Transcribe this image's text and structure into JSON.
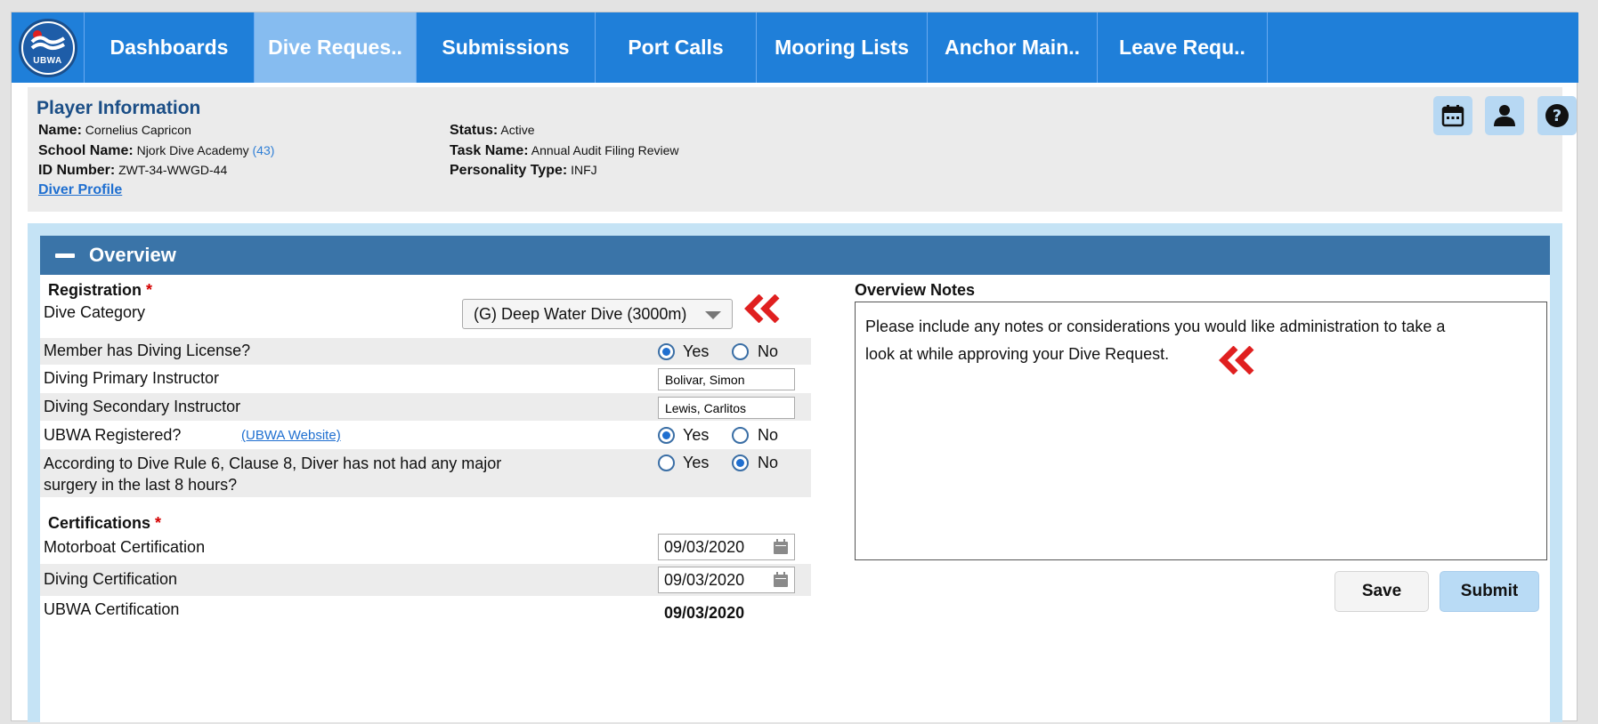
{
  "nav": {
    "logo_text": "UBWA",
    "tabs": [
      {
        "label": "Dashboards"
      },
      {
        "label": "Dive Reques.."
      },
      {
        "label": "Submissions"
      },
      {
        "label": "Port Calls"
      },
      {
        "label": "Mooring Lists"
      },
      {
        "label": "Anchor Main.."
      },
      {
        "label": "Leave Requ.."
      }
    ],
    "active_index": 1
  },
  "player": {
    "title": "Player Information",
    "name_label": "Name:",
    "name": "Cornelius Capricon",
    "school_label": "School Name:",
    "school": "Njork Dive Academy",
    "school_count": "(43)",
    "id_label": "ID Number:",
    "id": "ZWT-34-WWGD-44",
    "profile_link": "Diver Profile",
    "status_label": "Status:",
    "status": "Active",
    "task_label": "Task Name:",
    "task": "Annual Audit Filing Review",
    "personality_label": "Personality Type:",
    "personality": "INFJ",
    "icons": [
      "calendar-icon",
      "person-icon",
      "help-icon"
    ]
  },
  "overview": {
    "title": "Overview",
    "registration": {
      "title": "Registration",
      "required_mark": "*",
      "dive_category_label": "Dive Category",
      "dive_category_value": "(G) Deep Water Dive (3000m)",
      "license_label": "Member has Diving License?",
      "license_value": "Yes",
      "primary_label": "Diving Primary Instructor",
      "primary_value": "Bolivar, Simon",
      "secondary_label": "Diving Secondary Instructor",
      "secondary_value": "Lewis, Carlitos",
      "ubwa_label": "UBWA Registered?",
      "ubwa_link": "(UBWA Website)",
      "ubwa_value": "Yes",
      "surgery_label_1": "According to Dive Rule 6, Clause 8, Diver has not had any major",
      "surgery_label_2": "surgery in the last 8 hours?",
      "surgery_value": "No",
      "yes": "Yes",
      "no": "No"
    },
    "certifications": {
      "title": "Certifications",
      "required_mark": "*",
      "motorboat_label": "Motorboat Certification",
      "motorboat_date": "09/03/2020",
      "diving_label": "Diving Certification",
      "diving_date": "09/03/2020",
      "ubwa_label": "UBWA Certification",
      "ubwa_date": "09/03/2020"
    },
    "notes": {
      "title": "Overview Notes",
      "text_1": "Please include any notes or considerations you would like administration to take a",
      "text_2": "look at while approving your Dive Request."
    },
    "buttons": {
      "save": "Save",
      "submit": "Submit"
    }
  },
  "colors": {
    "nav": "#1f7fd9",
    "nav_active": "#86bcf0",
    "panel_header": "#3a74a8",
    "annotation_red": "#e02020"
  }
}
